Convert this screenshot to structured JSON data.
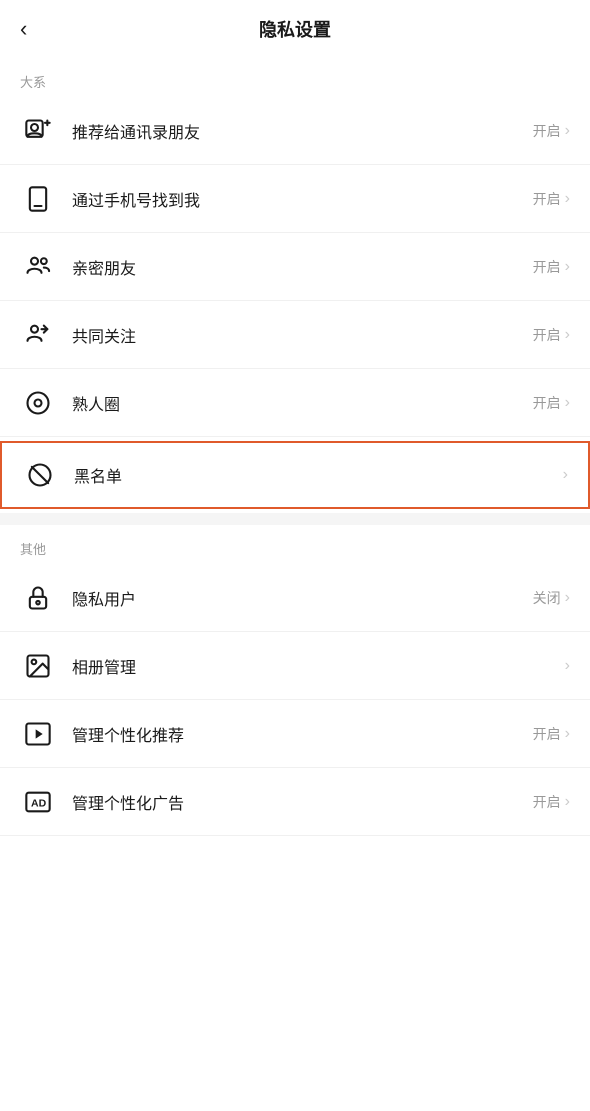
{
  "header": {
    "title": "隐私设置",
    "back_icon": "‹"
  },
  "sections": [
    {
      "label": "大系",
      "items": [
        {
          "id": "recommend-contacts",
          "icon": "person-add",
          "text": "推荐给通讯录朋友",
          "status": "开启",
          "has_status": true,
          "highlighted": false
        },
        {
          "id": "find-by-phone",
          "icon": "phone",
          "text": "通过手机号找到我",
          "status": "开启",
          "has_status": true,
          "highlighted": false
        },
        {
          "id": "close-friends",
          "icon": "close-friends",
          "text": "亲密朋友",
          "status": "开启",
          "has_status": true,
          "highlighted": false
        },
        {
          "id": "mutual-follow",
          "icon": "mutual-follow",
          "text": "共同关注",
          "status": "开启",
          "has_status": true,
          "highlighted": false
        },
        {
          "id": "acquaintance-circle",
          "icon": "circle",
          "text": "熟人圈",
          "status": "开启",
          "has_status": true,
          "highlighted": false
        },
        {
          "id": "blacklist",
          "icon": "block",
          "text": "黑名单",
          "status": "",
          "has_status": false,
          "highlighted": true
        }
      ]
    },
    {
      "label": "其他",
      "items": [
        {
          "id": "private-user",
          "icon": "lock",
          "text": "隐私用户",
          "status": "关闭",
          "has_status": true,
          "highlighted": false
        },
        {
          "id": "album-management",
          "icon": "album",
          "text": "相册管理",
          "status": "",
          "has_status": false,
          "highlighted": false
        },
        {
          "id": "manage-personalized",
          "icon": "play",
          "text": "管理个性化推荐",
          "status": "开启",
          "has_status": true,
          "highlighted": false
        },
        {
          "id": "manage-ads",
          "icon": "ad",
          "text": "管理个性化广告",
          "status": "开启",
          "has_status": true,
          "highlighted": false
        }
      ]
    }
  ]
}
